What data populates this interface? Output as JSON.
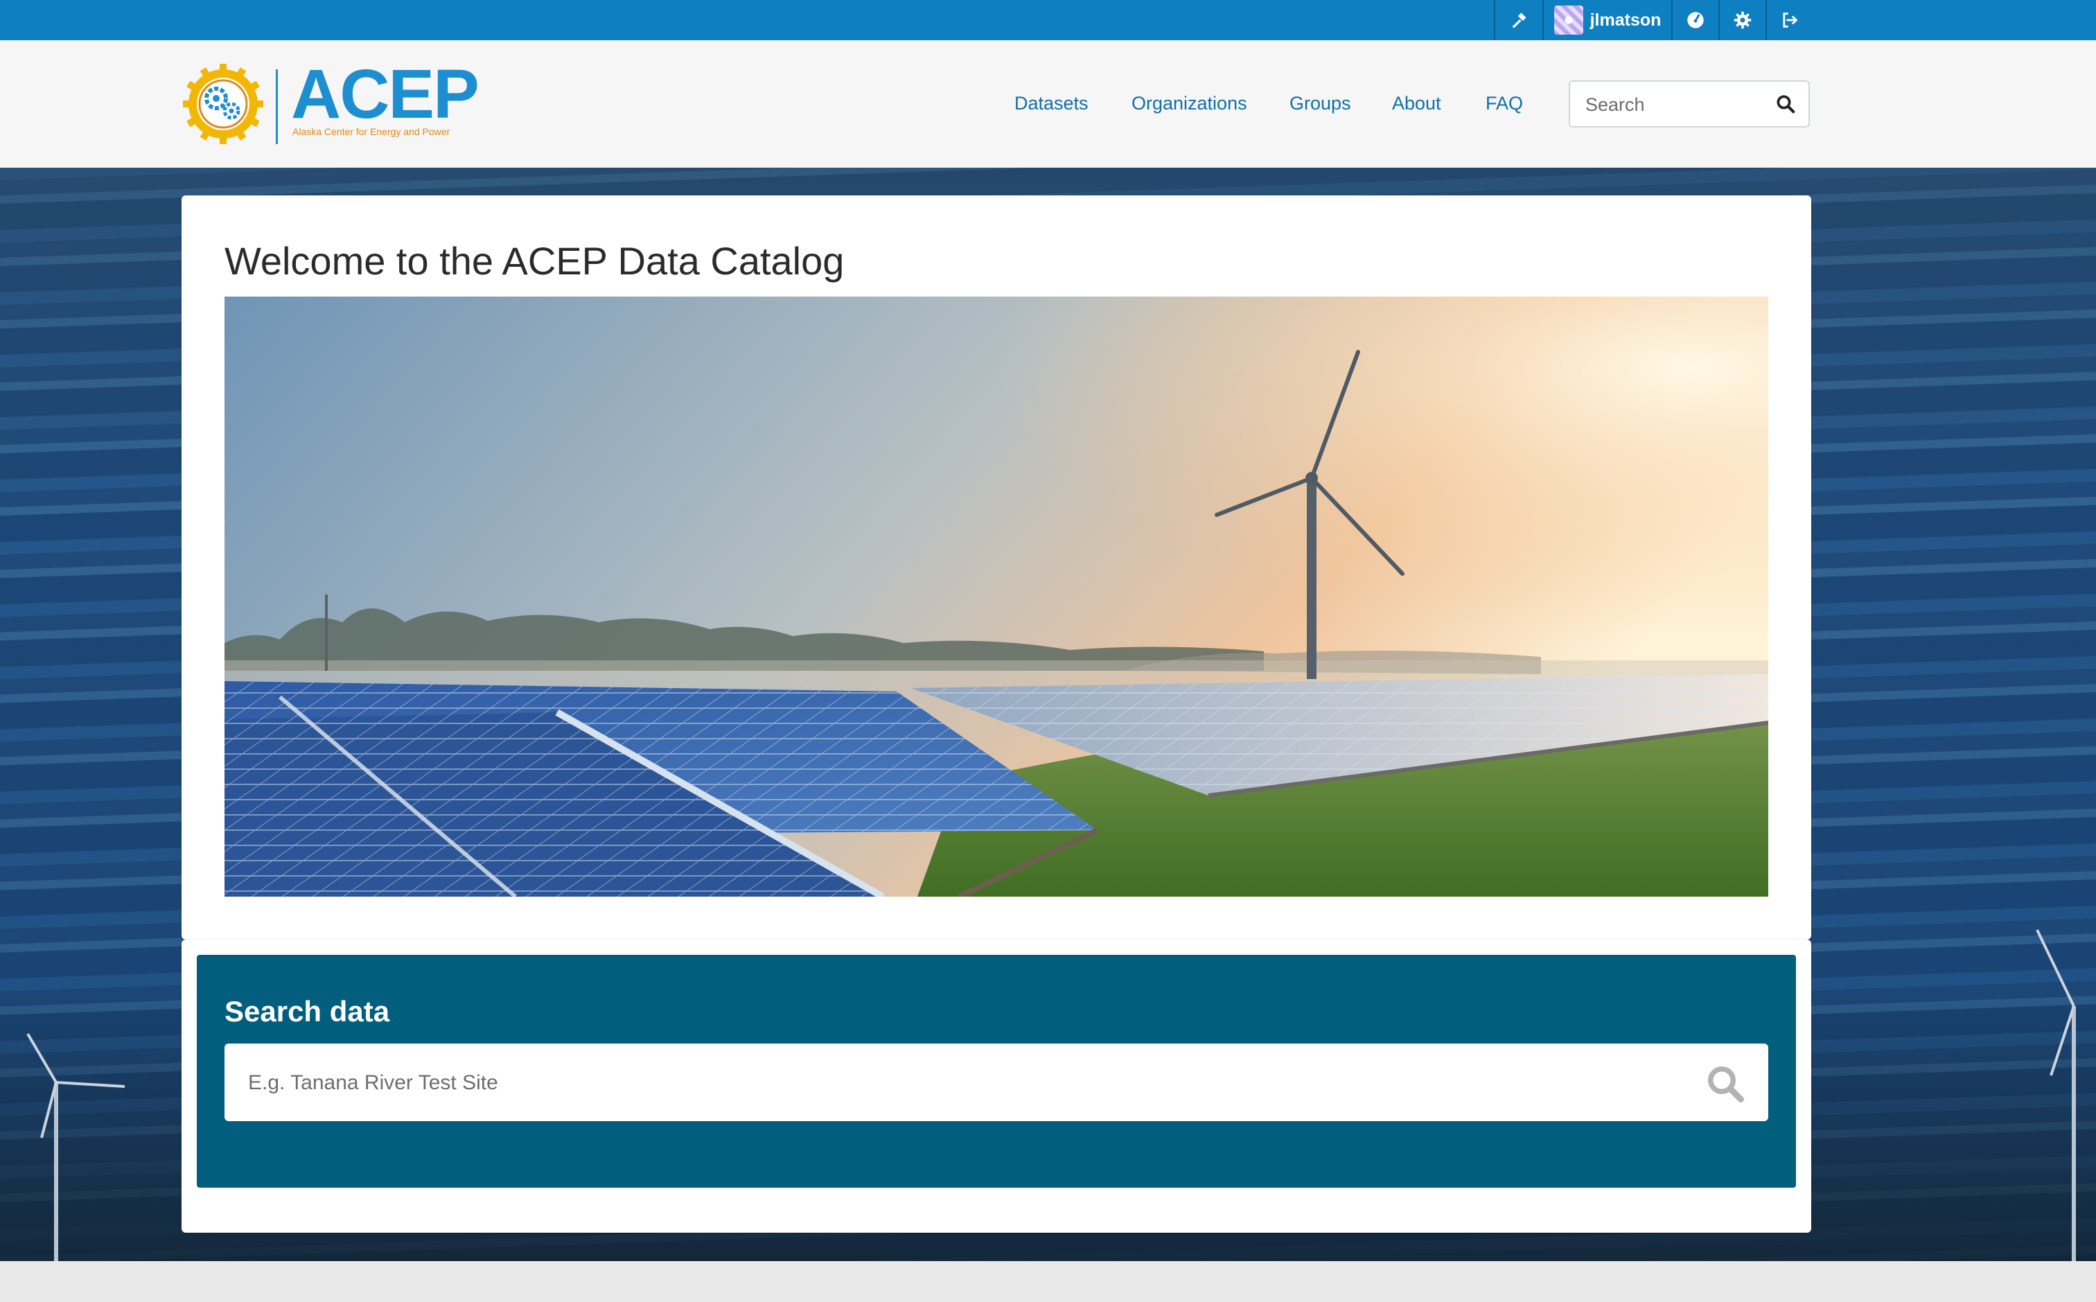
{
  "account_bar": {
    "username": "jlmatson",
    "items": [
      "sysadmin-icon",
      "avatar",
      "dashboard-icon",
      "settings-icon",
      "logout-icon"
    ]
  },
  "brand": {
    "name": "ACEP",
    "tagline": "Alaska Center for Energy and Power"
  },
  "nav": {
    "items": [
      {
        "label": "Datasets"
      },
      {
        "label": "Organizations"
      },
      {
        "label": "Groups"
      },
      {
        "label": "About"
      },
      {
        "label": "FAQ"
      }
    ]
  },
  "header_search": {
    "placeholder": "Search"
  },
  "welcome": {
    "title": "Welcome to the ACEP Data Catalog"
  },
  "search_data": {
    "title": "Search data",
    "placeholder": "E.g. Tanana River Test Site"
  },
  "colors": {
    "account_bar": "#0e7fc0",
    "brand_blue": "#1d8ed0",
    "brand_orange": "#e08a18",
    "nav_link": "#106fa8",
    "search_panel": "#025e7d"
  }
}
